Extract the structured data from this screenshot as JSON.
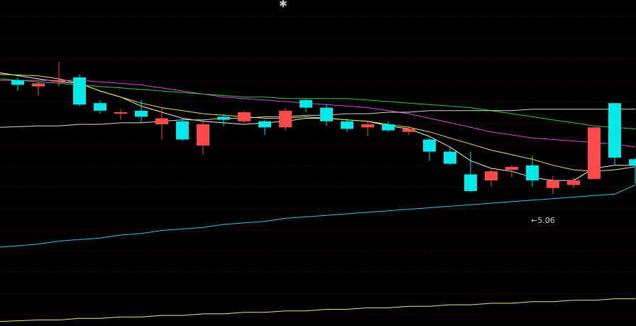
{
  "header": {
    "marker": "✱"
  },
  "annotation": {
    "low_text": "←5.06"
  },
  "colors": {
    "background": "#000000",
    "gridline": "#5a0000",
    "up": "#ff4a4a",
    "down": "#00e8e8",
    "ma_short": "#f0f0f0",
    "ma_mid": "#e8e840",
    "ma_long": "#e040e0",
    "ma_longer": "#20d040",
    "ma_longest": "#d8d8d8",
    "ma_cyan": "#30c8e8",
    "ma_yellow": "#e8e880"
  },
  "chart_data": {
    "type": "candlestick",
    "price_range": [
      4.35,
      6.5
    ],
    "grid": true,
    "low_marker": {
      "index": 25,
      "value": 5.06
    },
    "candles": [
      {
        "open": 5.97,
        "close": 5.94,
        "high": 5.99,
        "low": 5.9
      },
      {
        "open": 5.93,
        "close": 5.95,
        "high": 5.96,
        "low": 5.87
      },
      {
        "open": 5.96,
        "close": 5.97,
        "high": 6.09,
        "low": 5.93
      },
      {
        "open": 5.99,
        "close": 5.81,
        "high": 6.01,
        "low": 5.8
      },
      {
        "open": 5.82,
        "close": 5.77,
        "high": 5.84,
        "low": 5.75
      },
      {
        "open": 5.75,
        "close": 5.76,
        "high": 5.78,
        "low": 5.71
      },
      {
        "open": 5.77,
        "close": 5.73,
        "high": 5.84,
        "low": 5.69
      },
      {
        "open": 5.68,
        "close": 5.72,
        "high": 5.79,
        "low": 5.58
      },
      {
        "open": 5.7,
        "close": 5.58,
        "high": 5.72,
        "low": 5.57
      },
      {
        "open": 5.54,
        "close": 5.68,
        "high": 5.71,
        "low": 5.48
      },
      {
        "open": 5.73,
        "close": 5.71,
        "high": 5.75,
        "low": 5.67
      },
      {
        "open": 5.7,
        "close": 5.76,
        "high": 5.77,
        "low": 5.69
      },
      {
        "open": 5.7,
        "close": 5.66,
        "high": 5.71,
        "low": 5.61
      },
      {
        "open": 5.66,
        "close": 5.77,
        "high": 5.79,
        "low": 5.64
      },
      {
        "open": 5.84,
        "close": 5.79,
        "high": 5.85,
        "low": 5.76
      },
      {
        "open": 5.79,
        "close": 5.7,
        "high": 5.81,
        "low": 5.67
      },
      {
        "open": 5.7,
        "close": 5.65,
        "high": 5.72,
        "low": 5.63
      },
      {
        "open": 5.66,
        "close": 5.68,
        "high": 5.7,
        "low": 5.6
      },
      {
        "open": 5.68,
        "close": 5.64,
        "high": 5.7,
        "low": 5.63
      },
      {
        "open": 5.63,
        "close": 5.65,
        "high": 5.67,
        "low": 5.61
      },
      {
        "open": 5.58,
        "close": 5.5,
        "high": 5.59,
        "low": 5.44
      },
      {
        "open": 5.5,
        "close": 5.42,
        "high": 5.53,
        "low": 5.41
      },
      {
        "open": 5.35,
        "close": 5.24,
        "high": 5.5,
        "low": 5.23
      },
      {
        "open": 5.31,
        "close": 5.37,
        "high": 5.39,
        "low": 5.27
      },
      {
        "open": 5.38,
        "close": 5.4,
        "high": 5.41,
        "low": 5.33
      },
      {
        "open": 5.41,
        "close": 5.31,
        "high": 5.47,
        "low": 5.27
      },
      {
        "open": 5.26,
        "close": 5.31,
        "high": 5.34,
        "low": 5.22
      },
      {
        "open": 5.28,
        "close": 5.31,
        "high": 5.33,
        "low": 5.26
      },
      {
        "open": 5.32,
        "close": 5.66,
        "high": 5.66,
        "low": 5.32
      },
      {
        "open": 5.82,
        "close": 5.46,
        "high": 5.82,
        "low": 5.41
      },
      {
        "open": 5.45,
        "close": 5.41,
        "high": 5.46,
        "low": 5.29
      }
    ],
    "ma_lines": [
      {
        "key": "ma_short",
        "values": [
          6.02,
          5.98,
          5.96,
          5.95,
          5.9,
          5.86,
          5.8,
          5.76,
          5.72,
          5.7,
          5.69,
          5.68,
          5.69,
          5.7,
          5.72,
          5.72,
          5.71,
          5.7,
          5.67,
          5.65,
          5.6,
          5.53,
          5.44,
          5.39,
          5.37,
          5.33,
          5.31,
          5.31,
          5.39,
          5.41,
          5.41
        ]
      },
      {
        "key": "ma_mid",
        "values": [
          6.01,
          6.0,
          5.98,
          5.95,
          5.9,
          5.86,
          5.82,
          5.79,
          5.77,
          5.75,
          5.74,
          5.73,
          5.72,
          5.72,
          5.73,
          5.72,
          5.71,
          5.7,
          5.68,
          5.66,
          5.63,
          5.59,
          5.55,
          5.51,
          5.48,
          5.45,
          5.41,
          5.38,
          5.37,
          5.38,
          5.4
        ]
      },
      {
        "key": "ma_long",
        "values": [
          5.97,
          5.97,
          5.97,
          5.97,
          5.96,
          5.95,
          5.94,
          5.92,
          5.9,
          5.88,
          5.86,
          5.85,
          5.84,
          5.83,
          5.82,
          5.81,
          5.8,
          5.79,
          5.77,
          5.75,
          5.72,
          5.69,
          5.66,
          5.63,
          5.61,
          5.59,
          5.58,
          5.57,
          5.56,
          5.55,
          5.53
        ]
      },
      {
        "key": "ma_longer",
        "values": [
          5.98,
          5.96,
          5.95,
          5.94,
          5.93,
          5.92,
          5.91,
          5.9,
          5.89,
          5.88,
          5.87,
          5.86,
          5.86,
          5.85,
          5.85,
          5.85,
          5.85,
          5.84,
          5.83,
          5.82,
          5.81,
          5.8,
          5.79,
          5.77,
          5.75,
          5.73,
          5.71,
          5.69,
          5.67,
          5.66,
          5.65
        ]
      },
      {
        "key": "ma_longest",
        "values": [
          5.66,
          5.67,
          5.67,
          5.68,
          5.68,
          5.69,
          5.69,
          5.7,
          5.71,
          5.71,
          5.72,
          5.72,
          5.73,
          5.73,
          5.74,
          5.74,
          5.75,
          5.75,
          5.76,
          5.76,
          5.77,
          5.77,
          5.77,
          5.77,
          5.77,
          5.78,
          5.78,
          5.78,
          5.78,
          5.78,
          5.78
        ]
      },
      {
        "key": "ma_cyan",
        "values": [
          4.87,
          4.89,
          4.91,
          4.92,
          4.93,
          4.95,
          4.96,
          4.98,
          4.99,
          5.0,
          5.02,
          5.03,
          5.04,
          5.06,
          5.07,
          5.08,
          5.09,
          5.1,
          5.11,
          5.12,
          5.13,
          5.14,
          5.15,
          5.16,
          5.17,
          5.18,
          5.19,
          5.2,
          5.21,
          5.22,
          5.28
        ]
      },
      {
        "key": "ma_yellow",
        "values": [
          4.38,
          4.39,
          4.39,
          4.4,
          4.4,
          4.41,
          4.41,
          4.42,
          4.42,
          4.43,
          4.43,
          4.44,
          4.44,
          4.45,
          4.45,
          4.46,
          4.46,
          4.47,
          4.47,
          4.48,
          4.48,
          4.49,
          4.49,
          4.5,
          4.5,
          4.51,
          4.51,
          4.52,
          4.52,
          4.53,
          4.53
        ]
      }
    ]
  }
}
